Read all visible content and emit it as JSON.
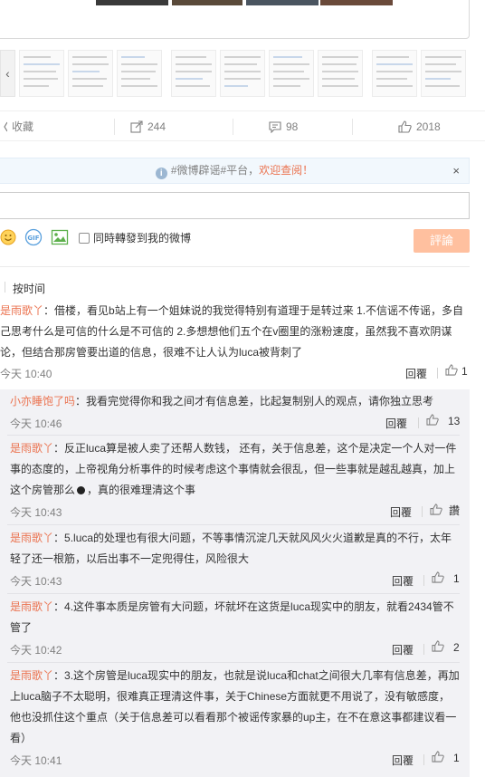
{
  "actions": {
    "favorite": "收藏",
    "forward": "244",
    "comment": "98",
    "like": "2018"
  },
  "notice": {
    "text": "#微博辟谣#平台，",
    "link": "欢迎查阅！",
    "close": "×"
  },
  "composer": {
    "repost_label": "同時轉發到我的微博",
    "submit_label": "評論"
  },
  "sort_label": "按时间",
  "main_comment": {
    "user": "是雨歌丫",
    "text": "：借楼，看见b站上有一个姐妹说的我觉得特别有道理于是转过来 1.不信谣不传谣，多自己思考什么是可信的什么是不可信的 2.多想想他们五个在v圈里的涨粉速度，虽然我不喜欢阴谋论，但结合那房管要出道的信息，很难不让人认为luca被背刺了",
    "time": "今天 10:40",
    "reply": "回覆",
    "likes": "1"
  },
  "replies": [
    {
      "user": "小亦睡饱了吗",
      "text": "：我看完觉得你和我之间才有信息差，比起复制别人的观点，请你独立思考",
      "time": "今天 10:46",
      "reply": "回覆",
      "likes": "13"
    },
    {
      "user": "是雨歌丫",
      "text": "：反正luca算是被人卖了还帮人数钱， 还有，关于信息差，这个是决定一个人对一件事的态度的，上帝视角分析事件的时候考虑这个事情就会很乱，但一些事就是越乱越真，加上这个房管那么",
      "text_after": "，真的很难理清这个事",
      "time": "今天 10:43",
      "reply": "回覆",
      "likes": "讚"
    },
    {
      "user": "是雨歌丫",
      "text": "：5.luca的处理也有很大问题，不等事情沉淀几天就风风火火道歉是真的不行，太年轻了还一根筋，以后出事不一定兜得住，风险很大",
      "time": "今天 10:43",
      "reply": "回覆",
      "likes": "1"
    },
    {
      "user": "是雨歌丫",
      "text": "：4.这件事本质是房管有大问题，坏就坏在这货是luca现实中的朋友，就看2434管不管了",
      "time": "今天 10:42",
      "reply": "回覆",
      "likes": "2"
    },
    {
      "user": "是雨歌丫",
      "text": "：3.这个房管是luca现实中的朋友，也就是说luca和chat之间很大几率有信息差，再加上luca脑子不太聪明，很难真正理清这件事，关于Chinese方面就更不用说了，没有敏感度，他也没抓住这个重点（关于信息差可以看看那个被谣传家暴的up主，在不在意这事都建议看一看）",
      "time": "今天 10:41",
      "reply": "回覆",
      "likes": "1"
    }
  ],
  "icons": {
    "favorite": "star-icon",
    "forward": "share-icon",
    "comment": "comment-icon",
    "like": "thumbs-up-icon"
  },
  "colors": {
    "accent": "#eb7350",
    "submit": "#ffc09f",
    "notice_bg": "#f2f8fd",
    "reply_bg": "#f2f2f5"
  }
}
